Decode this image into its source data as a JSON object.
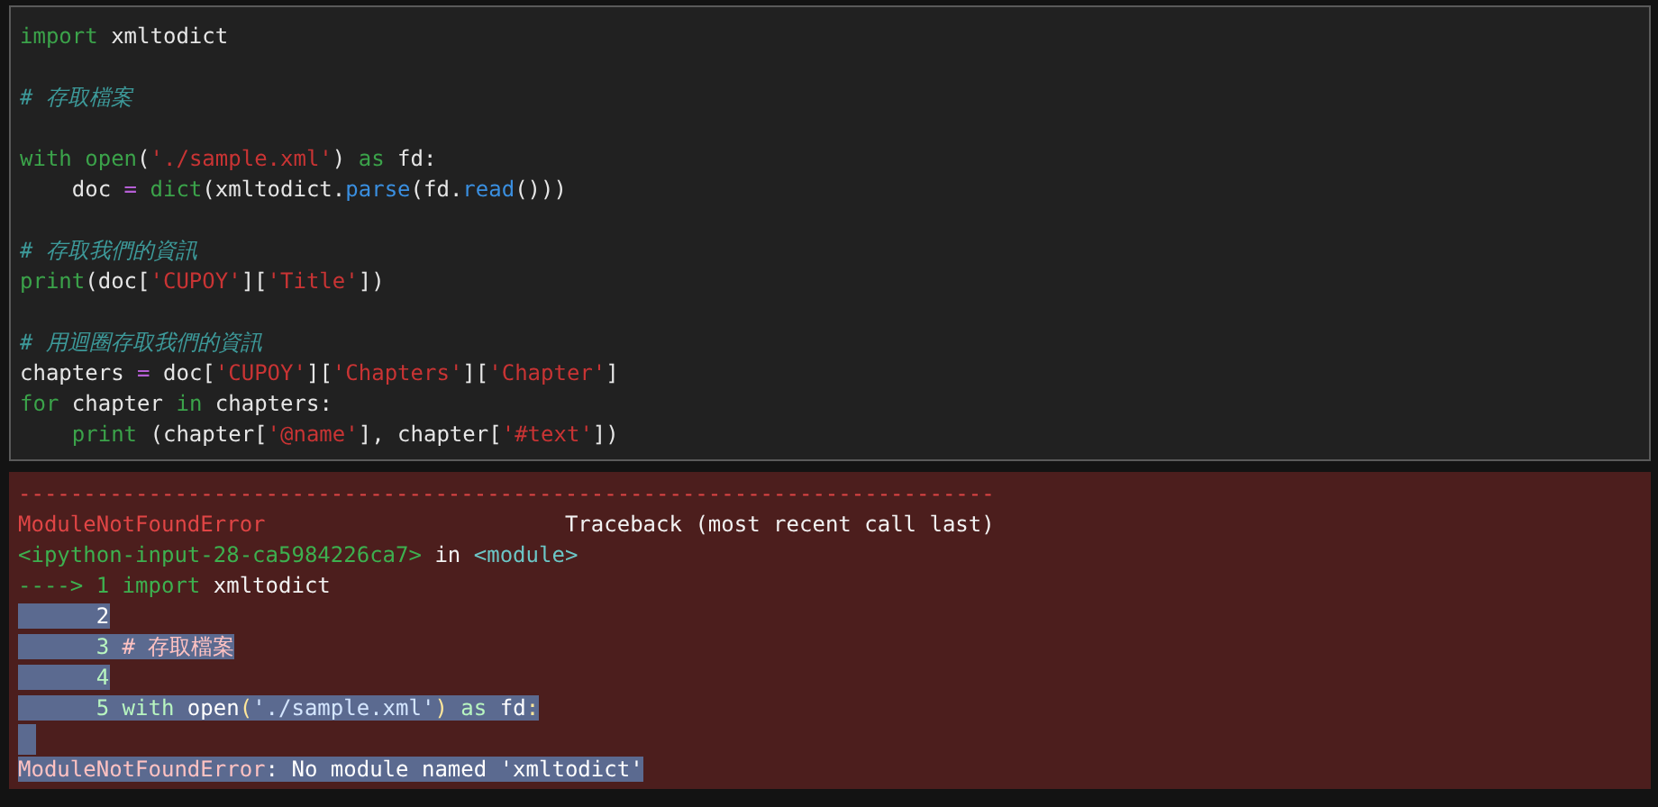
{
  "code_cell": {
    "lines": [
      {
        "kind": "code",
        "tokens": [
          {
            "t": "import",
            "kind": "kw"
          },
          {
            "t": " xmltodict",
            "kind": "name"
          }
        ]
      },
      {
        "kind": "blank"
      },
      {
        "kind": "code",
        "tokens": [
          {
            "t": "# 存取檔案",
            "kind": "com"
          }
        ]
      },
      {
        "kind": "blank"
      },
      {
        "kind": "code",
        "tokens": [
          {
            "t": "with",
            "kind": "kw"
          },
          {
            "t": " open",
            "kind": "kw"
          },
          {
            "t": "(",
            "kind": "name"
          },
          {
            "t": "'./sample.xml'",
            "kind": "str"
          },
          {
            "t": ") ",
            "kind": "name"
          },
          {
            "t": "as",
            "kind": "kw"
          },
          {
            "t": " fd:",
            "kind": "name"
          }
        ]
      },
      {
        "kind": "code",
        "tokens": [
          {
            "t": "    doc ",
            "kind": "name"
          },
          {
            "t": "=",
            "kind": "op"
          },
          {
            "t": " dict",
            "kind": "kw"
          },
          {
            "t": "(xmltodict.",
            "kind": "name"
          },
          {
            "t": "parse",
            "kind": "attr"
          },
          {
            "t": "(fd.",
            "kind": "name"
          },
          {
            "t": "read",
            "kind": "attr"
          },
          {
            "t": "()))",
            "kind": "name"
          }
        ]
      },
      {
        "kind": "blank"
      },
      {
        "kind": "code",
        "tokens": [
          {
            "t": "# 存取我們的資訊",
            "kind": "com"
          }
        ]
      },
      {
        "kind": "code",
        "tokens": [
          {
            "t": "print",
            "kind": "kw"
          },
          {
            "t": "(doc[",
            "kind": "name"
          },
          {
            "t": "'CUPOY'",
            "kind": "str"
          },
          {
            "t": "][",
            "kind": "name"
          },
          {
            "t": "'Title'",
            "kind": "str"
          },
          {
            "t": "])",
            "kind": "name"
          }
        ]
      },
      {
        "kind": "blank"
      },
      {
        "kind": "code",
        "tokens": [
          {
            "t": "# 用迴圈存取我們的資訊",
            "kind": "com"
          }
        ]
      },
      {
        "kind": "code",
        "tokens": [
          {
            "t": "chapters ",
            "kind": "name"
          },
          {
            "t": "=",
            "kind": "op"
          },
          {
            "t": " doc[",
            "kind": "name"
          },
          {
            "t": "'CUPOY'",
            "kind": "str"
          },
          {
            "t": "][",
            "kind": "name"
          },
          {
            "t": "'Chapters'",
            "kind": "str"
          },
          {
            "t": "][",
            "kind": "name"
          },
          {
            "t": "'Chapter'",
            "kind": "str"
          },
          {
            "t": "]",
            "kind": "name"
          }
        ]
      },
      {
        "kind": "code",
        "tokens": [
          {
            "t": "for",
            "kind": "kw"
          },
          {
            "t": " chapter ",
            "kind": "name"
          },
          {
            "t": "in",
            "kind": "kw"
          },
          {
            "t": " chapters:",
            "kind": "name"
          }
        ]
      },
      {
        "kind": "code",
        "tokens": [
          {
            "t": "    print",
            "kind": "kw"
          },
          {
            "t": " (chapter[",
            "kind": "name"
          },
          {
            "t": "'@name'",
            "kind": "str"
          },
          {
            "t": "], chapter[",
            "kind": "name"
          },
          {
            "t": "'#text'",
            "kind": "str"
          },
          {
            "t": "])",
            "kind": "name"
          }
        ]
      }
    ]
  },
  "output": {
    "lines": [
      {
        "kind": "text",
        "selected": false,
        "tokens": [
          {
            "t": "---------------------------------------------------------------------------",
            "kind": "err"
          }
        ]
      },
      {
        "kind": "text",
        "selected": false,
        "tokens": [
          {
            "t": "ModuleNotFoundError",
            "kind": "err"
          },
          {
            "t": "                       Traceback (most recent call last)",
            "kind": "plain"
          }
        ]
      },
      {
        "kind": "text",
        "selected": false,
        "tokens": [
          {
            "t": "<ipython-input-28-ca5984226ca7>",
            "kind": "green"
          },
          {
            "t": " in ",
            "kind": "plain"
          },
          {
            "t": "<module>",
            "kind": "cyan"
          }
        ]
      },
      {
        "kind": "text",
        "selected": false,
        "tokens": [
          {
            "t": "----> 1 ",
            "kind": "green"
          },
          {
            "t": "import",
            "kind": "green"
          },
          {
            "t": " xmltodict",
            "kind": "plain"
          }
        ]
      },
      {
        "kind": "text",
        "selected": true,
        "tokens": [
          {
            "t": "      2",
            "kind": "num"
          }
        ]
      },
      {
        "kind": "text",
        "selected": true,
        "tokens": [
          {
            "t": "      3 ",
            "kind": "green"
          },
          {
            "t": "# 存取檔案",
            "kind": "err"
          }
        ]
      },
      {
        "kind": "text",
        "selected": true,
        "tokens": [
          {
            "t": "      4",
            "kind": "green"
          }
        ]
      },
      {
        "kind": "text",
        "selected": true,
        "tokens": [
          {
            "t": "      5 ",
            "kind": "green"
          },
          {
            "t": "with",
            "kind": "green"
          },
          {
            "t": " open",
            "kind": "plain"
          },
          {
            "t": "(",
            "kind": "yellow"
          },
          {
            "t": "'./sample.xml'",
            "kind": "blue"
          },
          {
            "t": ")",
            "kind": "yellow"
          },
          {
            "t": " as",
            "kind": "green"
          },
          {
            "t": " fd",
            "kind": "plain"
          },
          {
            "t": ":",
            "kind": "yellow"
          }
        ]
      },
      {
        "kind": "blank",
        "selected": true
      },
      {
        "kind": "text",
        "selected": true,
        "tokens": [
          {
            "t": "ModuleNotFoundError",
            "kind": "err"
          },
          {
            "t": ": No module named 'xmltodict'",
            "kind": "plain"
          }
        ]
      }
    ]
  }
}
